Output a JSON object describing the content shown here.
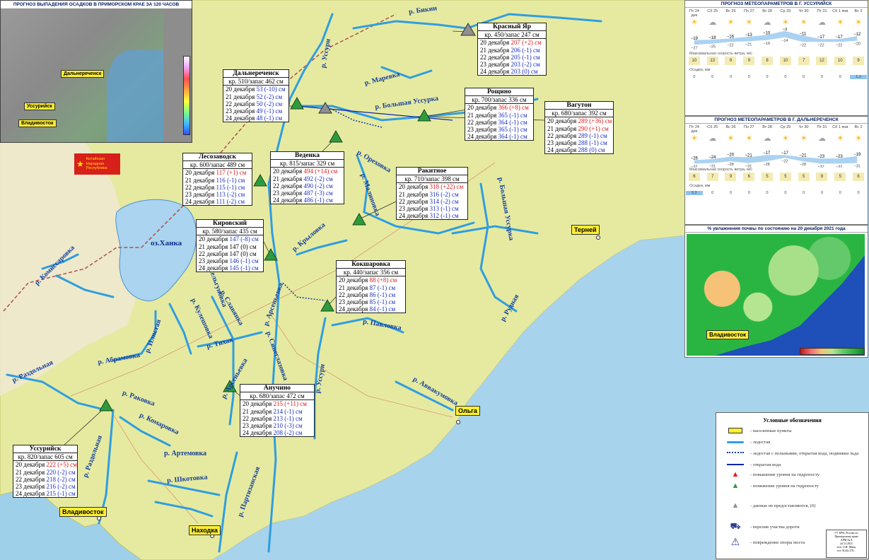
{
  "precip_inset": {
    "title": "ПРОГНОЗ ВЫПАДЕНИЯ ОСАДКОВ В ПРИМОРСКОМ КРАЕ ЗА 120 ЧАСОВ",
    "labels": [
      "Дальнереченск",
      "Уссурийск",
      "Владивосток"
    ]
  },
  "china_label": "Китайская Народная Республика",
  "cities": [
    {
      "name": "Терней"
    },
    {
      "name": "Ольга"
    },
    {
      "name": "Владивосток"
    },
    {
      "name": "Находка"
    }
  ],
  "lake": "оз.Ханка",
  "rivers": [
    "р. Бикин",
    "р. Уссури",
    "р. Маревка",
    "р. Большая Уссурка",
    "р. Ореховка",
    "р. Малиновка",
    "р. Большая Уссурка",
    "р. Крыловка",
    "р. Комиссаровка",
    "р. Мельгуновка",
    "р. Кулешовка",
    "р. Славянка",
    "р. Арсеньевка",
    "р. Илистая",
    "р. Абрамовка",
    "р. Тихая",
    "р. Синеглазовка",
    "р. Павловка",
    "р. Уссури",
    "р. Рудная",
    "р. Аввакумовка",
    "р. Раздольная",
    "р. Раковка",
    "р. Комаровка",
    "р. Раздольная",
    "р. Арсеньевка",
    "р. Артемовка",
    "р. Шкотовка",
    "р. Партизанская"
  ],
  "stations": [
    {
      "name": "Красный Яр",
      "key": "кр. 450/запас 247 см",
      "rows": [
        {
          "d": "20 декабря",
          "v": "207 (+2) см",
          "up": true
        },
        {
          "d": "21 декабря",
          "v": "206 (-1) см"
        },
        {
          "d": "22 декабря",
          "v": "205 (-1) см"
        },
        {
          "d": "23 декабря",
          "v": "203 (-2) см"
        },
        {
          "d": "24 декабря",
          "v": "203 (0) см"
        }
      ]
    },
    {
      "name": "Дальнереченск",
      "key": "кр. 510/запас 462 см",
      "rows": [
        {
          "d": "20 декабря",
          "v": "53 (-10) см"
        },
        {
          "d": "21 декабря",
          "v": "52 (-2) см"
        },
        {
          "d": "22 декабря",
          "v": "50 (-2) см"
        },
        {
          "d": "23 декабря",
          "v": "49 (-1) см"
        },
        {
          "d": "24 декабря",
          "v": "48 (-1) см"
        }
      ]
    },
    {
      "name": "Рощино",
      "key": "кр. 700/запас 336 см",
      "rows": [
        {
          "d": "20 декабря",
          "v": "366 (+8) см",
          "up": true
        },
        {
          "d": "21 декабря",
          "v": "365 (-1) см"
        },
        {
          "d": "22 декабря",
          "v": "364 (-1) см"
        },
        {
          "d": "23 декабря",
          "v": "365 (-1) см"
        },
        {
          "d": "24 декабря",
          "v": "364 (-1) см"
        }
      ]
    },
    {
      "name": "Вагутон",
      "key": "кр. 680/запас 392 см",
      "rows": [
        {
          "d": "20 декабря",
          "v": "289 (+36) см",
          "up": true
        },
        {
          "d": "21 декабря",
          "v": "290 (+1) см",
          "up": true
        },
        {
          "d": "22 декабря",
          "v": "289 (-1) см"
        },
        {
          "d": "23 декабря",
          "v": "288 (-1) см"
        },
        {
          "d": "24 декабря",
          "v": "288 (0) см"
        }
      ]
    },
    {
      "name": "Лесозаводск",
      "key": "кр. 600/запас 489 см",
      "rows": [
        {
          "d": "20 декабря",
          "v": "117 (+1) см",
          "up": true
        },
        {
          "d": "21 декабря",
          "v": "116 (-1) см"
        },
        {
          "d": "22 декабря",
          "v": "115 (-1) см"
        },
        {
          "d": "23 декабря",
          "v": "113 (-2) см"
        },
        {
          "d": "24 декабря",
          "v": "111 (-2) см"
        }
      ]
    },
    {
      "name": "Веденка",
      "key": "кр. 815/запас 329 см",
      "rows": [
        {
          "d": "20 декабря",
          "v": "494 (+14) см",
          "up": true
        },
        {
          "d": "21 декабря",
          "v": "492 (-2) см"
        },
        {
          "d": "22 декабря",
          "v": "490 (-2) см"
        },
        {
          "d": "23 декабря",
          "v": "487 (-3) см"
        },
        {
          "d": "24 декабря",
          "v": "486 (-1) см"
        }
      ]
    },
    {
      "name": "Ракитное",
      "key": "кр. 710/запас 398 см",
      "rows": [
        {
          "d": "20 декабря",
          "v": "318 (+22) см",
          "up": true
        },
        {
          "d": "21 декабря",
          "v": "316 (-2) см"
        },
        {
          "d": "22 декабря",
          "v": "314 (-2) см"
        },
        {
          "d": "23 декабря",
          "v": "313 (-1) см"
        },
        {
          "d": "24 декабря",
          "v": "312 (-1) см"
        }
      ]
    },
    {
      "name": "Кировский",
      "key": "кр. 580/запас 435 см",
      "rows": [
        {
          "d": "20 декабря",
          "v": "147 (-8) см"
        },
        {
          "d": "21 декабря",
          "v": "147 (0) см",
          "plain": true
        },
        {
          "d": "22 декабря",
          "v": "147 (0) см",
          "plain": true
        },
        {
          "d": "23 декабря",
          "v": "146 (-1) см"
        },
        {
          "d": "24 декабря",
          "v": "145 (-1) см"
        }
      ]
    },
    {
      "name": "Кокшаровка",
      "key": "кр. 440/запас 356 см",
      "rows": [
        {
          "d": "20 декабря",
          "v": "88 (+8) см",
          "up": true
        },
        {
          "d": "21 декабря",
          "v": "87 (-1) см"
        },
        {
          "d": "22 декабря",
          "v": "86 (-1) см"
        },
        {
          "d": "23 декабря",
          "v": "85 (-1) см"
        },
        {
          "d": "24 декабря",
          "v": "84 (-1) см"
        }
      ]
    },
    {
      "name": "Анучино",
      "key": "кр. 680/запас 472 см",
      "rows": [
        {
          "d": "20 декабря",
          "v": "215 (+11) см",
          "up": true
        },
        {
          "d": "21 декабря",
          "v": "214 (-1) см"
        },
        {
          "d": "22 декабря",
          "v": "213 (-1) см"
        },
        {
          "d": "23 декабря",
          "v": "210 (-3) см"
        },
        {
          "d": "24 декабря",
          "v": "208 (-2) см"
        }
      ]
    },
    {
      "name": "Уссурийск",
      "key": "кр. 820/запас 605 см",
      "rows": [
        {
          "d": "20 декабря",
          "v": "222 (+5) см",
          "up": true
        },
        {
          "d": "21 декабря",
          "v": "220 (-2) см"
        },
        {
          "d": "22 декабря",
          "v": "218 (-2) см"
        },
        {
          "d": "23 декабря",
          "v": "216 (-2) см"
        },
        {
          "d": "24 декабря",
          "v": "215 (-1) см"
        }
      ]
    }
  ],
  "meteo_ussuriysk": {
    "title": "ПРОГНОЗ МЕТЕОПАРАМЕТРОВ В Г. УССУРИЙСК",
    "days": [
      "Пт 24 дек",
      "Сб 25",
      "Вс 26",
      "Пн 27",
      "Вт 28",
      "Ср 29",
      "Чт 30",
      "Пт 31",
      "Сб 1 янв",
      "Вс 2"
    ],
    "tmax": [
      "−19",
      "−18",
      "−16",
      "−13",
      "−10",
      "−3",
      "−11",
      "−17",
      "−17",
      "−12"
    ],
    "tmin": [
      "−27",
      "−25",
      "−22",
      "−21",
      "−19",
      "−14",
      "−22",
      "−22",
      "−22",
      "−20"
    ],
    "wind_label": "Максимальная скорость ветра, м/с",
    "wind": [
      "10",
      "13",
      "9",
      "9",
      "8",
      "10",
      "7",
      "12",
      "10",
      "9"
    ],
    "precip_label": "Осадки, мм",
    "precip": [
      "0",
      "0",
      "0",
      "0",
      "0",
      "0",
      "0",
      "0",
      "0",
      "1.2"
    ]
  },
  "meteo_dalnerechensk": {
    "title": "ПРОГНОЗ МЕТЕОПАРАМЕТРОВ В Г. ДАЛЬНЕРЕЧЕНСК",
    "days": [
      "Пт 24 дек",
      "Сб 25",
      "Вс 26",
      "Пн 27",
      "Вт 28",
      "Ср 29",
      "Чт 30",
      "Пт 31",
      "Сб 1 янв",
      "Вс 2"
    ],
    "tmax": [
      "−26",
      "−24",
      "−20",
      "−21",
      "−17",
      "−17",
      "−21",
      "−23",
      "−23",
      "−19"
    ],
    "tmin": [
      "−32",
      "−31",
      "−28",
      "−31",
      "−28",
      "−22",
      "−28",
      "−32",
      "−32",
      "−31"
    ],
    "wind_label": "Максимальная скорость ветра, м/с",
    "wind": [
      "6",
      "7",
      "9",
      "6",
      "5",
      "5",
      "5",
      "8",
      "5",
      "6"
    ],
    "precip_label": "Осадки, мм",
    "precip": [
      "0.2",
      "0",
      "0",
      "0",
      "0",
      "0",
      "0",
      "0",
      "0",
      "0"
    ]
  },
  "soil": {
    "title": "% увлажнения почвы по состоянию на 20 декабря 2021 года",
    "city": "Владивосток"
  },
  "legend": {
    "title": "Условные обозначения",
    "items": [
      "- населенные пункты",
      "- ледостав",
      "- ледостав с полыньями, открытая вода, подвижки льда",
      "- открытая вода",
      "- повышение уровня на гидропосту",
      "- понижение уровня на гидропосту",
      "- данные не предоставляются, (0)",
      "- перелив участка дороги",
      "- повреждение опоры моста"
    ],
    "stamp": [
      "ГУ МЧС России по",
      "Приморскому краю",
      "АРМ № 8",
      "24.12.2021",
      "исп. О.И. Швец",
      "тел. 8(42) 278..."
    ]
  }
}
